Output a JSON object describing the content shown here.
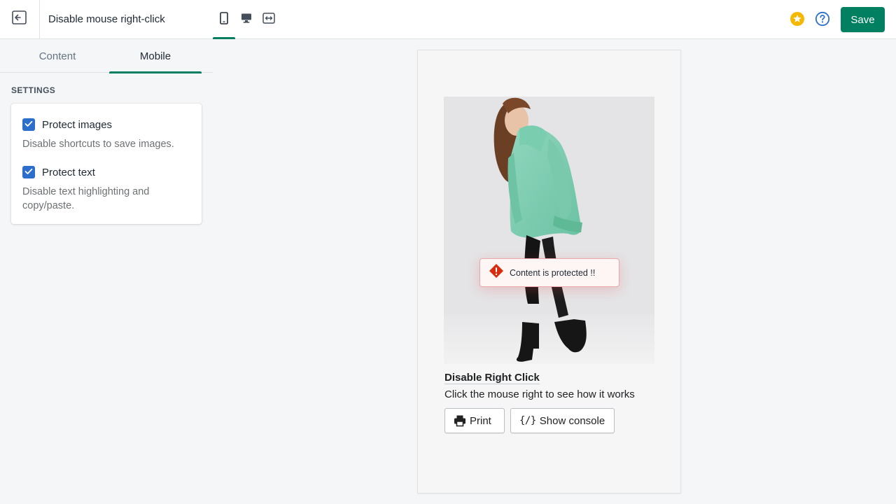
{
  "topbar": {
    "title": "Disable mouse right-click",
    "save_label": "Save",
    "device_modes": [
      "mobile",
      "desktop",
      "full-width"
    ],
    "active_device": "mobile"
  },
  "sidebar": {
    "tabs": [
      {
        "label": "Content",
        "active": false
      },
      {
        "label": "Mobile",
        "active": true
      }
    ],
    "settings_heading": "SETTINGS",
    "options": [
      {
        "label": "Protect images",
        "checked": true,
        "help": "Disable shortcuts to save images."
      },
      {
        "label": "Protect text",
        "checked": true,
        "help": "Disable text highlighting and copy/paste."
      }
    ]
  },
  "preview": {
    "toast": "Content is protected !!",
    "title": "Disable Right Click",
    "subtitle": "Click the mouse right to see how it works",
    "print_label": "Print",
    "console_label": "Show console"
  },
  "colors": {
    "primary": "#008060",
    "checkbox": "#2c6ecb",
    "star": "#f5b800",
    "help": "#2c6ecb",
    "toast_icon": "#d72c0d"
  }
}
